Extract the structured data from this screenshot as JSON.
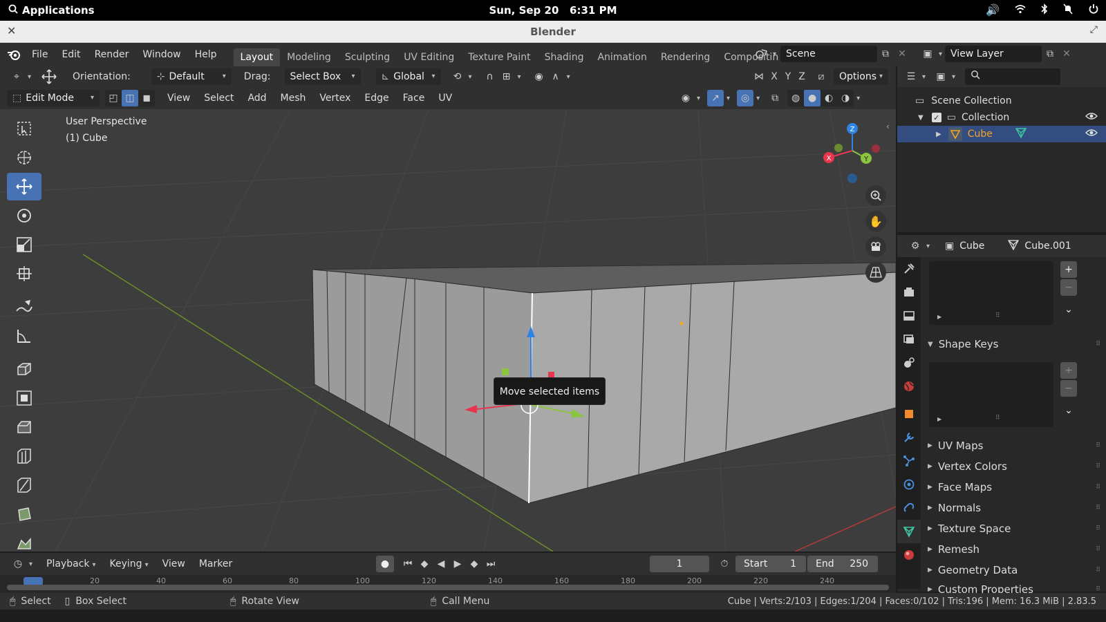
{
  "system": {
    "applications": "Applications",
    "clock": "Sun, Sep 20   6:31 PM"
  },
  "window": {
    "title": "Blender"
  },
  "menu": {
    "items": [
      "File",
      "Edit",
      "Render",
      "Window",
      "Help"
    ],
    "workspaces": [
      "Layout",
      "Modeling",
      "Sculpting",
      "UV Editing",
      "Texture Paint",
      "Shading",
      "Animation",
      "Rendering",
      "Compositin"
    ],
    "active_workspace": "Layout",
    "scene": "Scene",
    "view_layer": "View Layer"
  },
  "tool_header": {
    "orientation_label": "Orientation:",
    "orientation_value": "Default",
    "drag_label": "Drag:",
    "drag_value": "Select Box",
    "transform_value": "Global",
    "axes": [
      "X",
      "Y",
      "Z"
    ],
    "options": "Options"
  },
  "editor_header": {
    "mode": "Edit Mode",
    "menus": [
      "View",
      "Select",
      "Add",
      "Mesh",
      "Vertex",
      "Edge",
      "Face",
      "UV"
    ]
  },
  "viewport": {
    "perspective": "User Perspective",
    "object": "(1) Cube",
    "tooltip": "Move selected items",
    "gizmo": {
      "x": "X",
      "y": "Y",
      "z": "Z"
    }
  },
  "outliner": {
    "scene_collection": "Scene Collection",
    "collection": "Collection",
    "cube": "Cube"
  },
  "properties": {
    "object_name": "Cube",
    "mesh_name": "Cube.001",
    "shape_keys": "Shape Keys",
    "panels": [
      "UV Maps",
      "Vertex Colors",
      "Face Maps",
      "Normals",
      "Texture Space",
      "Remesh",
      "Geometry Data",
      "Custom Properties"
    ]
  },
  "timeline": {
    "menus": [
      "Playback",
      "Keying",
      "View",
      "Marker"
    ],
    "current_frame": "1",
    "start_label": "Start",
    "start_value": "1",
    "end_label": "End",
    "end_value": "250",
    "ruler": [
      "20",
      "40",
      "60",
      "80",
      "100",
      "120",
      "140",
      "160",
      "180",
      "200",
      "220",
      "240"
    ]
  },
  "statusbar": {
    "select": "Select",
    "box_select": "Box Select",
    "rotate_view": "Rotate View",
    "call_menu": "Call Menu",
    "stats": "Cube | Verts:2/103 | Edges:1/204 | Faces:0/102 | Tris:196 | Mem: 16.3 MiB | 2.83.5"
  },
  "colors": {
    "accent": "#4772b3",
    "selection": "#334d80",
    "axis_x": "#e8364f",
    "axis_y": "#8bc43f",
    "axis_z": "#2f83e3",
    "object_orange": "#f5a623"
  }
}
